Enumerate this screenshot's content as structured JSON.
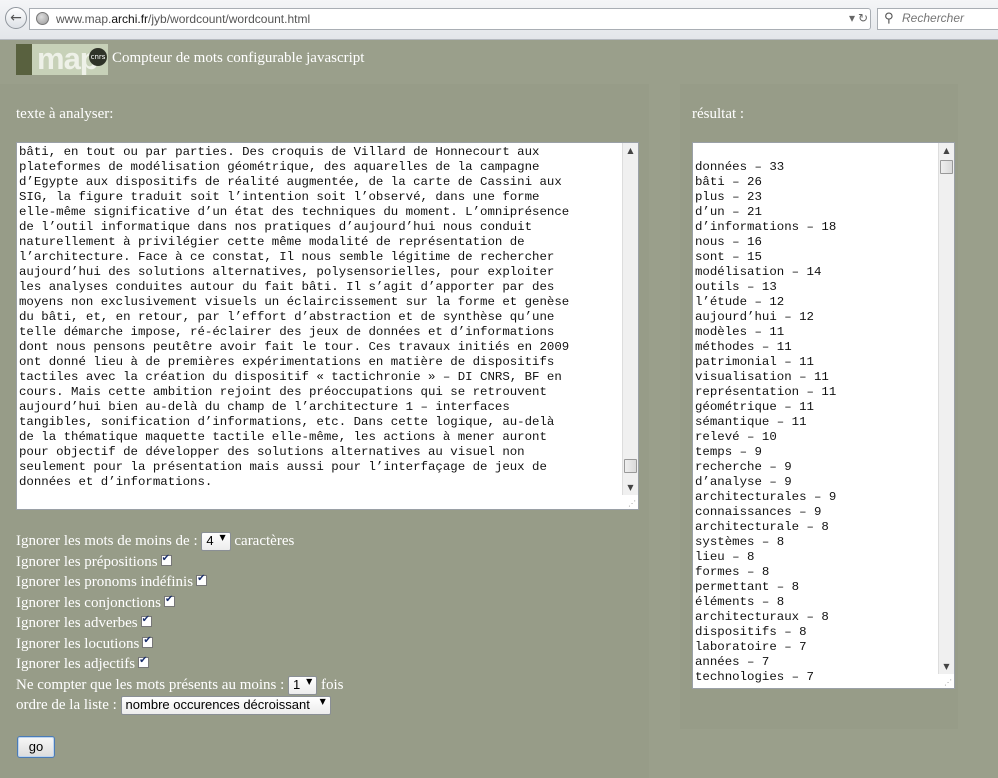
{
  "browser": {
    "url_prefix": "www.map.",
    "url_host": "archi.fr",
    "url_path": "/jyb/wordcount/wordcount.html",
    "search_placeholder": "Rechercher"
  },
  "header": {
    "logo_text": "map",
    "logo_seal": "cnrs",
    "title": "Compteur de mots configurable javascript"
  },
  "input": {
    "label": "texte à analyser:",
    "lines": [
      "bâti, en tout ou par parties. Des croquis de Villard de Honnecourt aux",
      "plateformes de modélisation géométrique, des aquarelles de la campagne",
      "d’Egypte aux dispositifs de réalité augmentée, de la carte de Cassini aux",
      "SIG, la figure traduit soit l’intention soit l’observé, dans une forme",
      "elle-même significative d’un état des techniques du moment. L’omniprésence",
      "de l’outil informatique dans nos pratiques d’aujourd’hui nous conduit",
      "naturellement à privilégier cette même modalité de représentation de",
      "l’architecture. Face à ce constat, Il nous semble légitime de rechercher",
      "aujourd’hui des solutions alternatives, polysensorielles, pour exploiter",
      "les analyses conduites autour du fait bâti. Il s’agit d’apporter par des",
      "moyens non exclusivement visuels un éclaircissement sur la forme et genèse",
      "du bâti, et, en retour, par l’effort d’abstraction et de synthèse qu’une",
      "telle démarche impose, ré-éclairer des jeux de données et d’informations",
      "dont nous pensons peutêtre avoir fait le tour. Ces travaux initiés en 2009",
      "ont donné lieu à de premières expérimentations en matière de dispositifs",
      "tactiles avec la création du dispositif « tactichronie » – DI CNRS, BF en",
      "cours. Mais cette ambition rejoint des préoccupations qui se retrouvent",
      "aujourd’hui bien au-delà du champ de l’architecture 1 – interfaces",
      "tangibles, sonification d’informations, etc. Dans cette logique, au-delà",
      "de la thématique maquette tactile elle-même, les actions à mener auront",
      "pour objectif de développer des solutions alternatives au visuel non",
      "seulement pour la présentation mais aussi pour l’interfaçage de jeux de",
      "données et d’informations."
    ]
  },
  "result": {
    "label": "résultat :",
    "lines": [
      "",
      "données – 33",
      "bâti – 26",
      "plus – 23",
      "d’un – 21",
      "d’informations – 18",
      "nous – 16",
      "sont – 15",
      "modélisation – 14",
      "outils – 13",
      "l’étude – 12",
      "aujourd’hui – 12",
      "modèles – 11",
      "méthodes – 11",
      "patrimonial – 11",
      "visualisation – 11",
      "représentation – 11",
      "géométrique – 11",
      "sémantique – 11",
      "relevé – 10",
      "temps – 9",
      "recherche – 9",
      "d’analyse – 9",
      "architecturales – 9",
      "connaissances – 9",
      "architecturale – 8",
      "systèmes – 8",
      "lieu – 8",
      "formes – 8",
      "permettant – 8",
      "éléments – 8",
      "architecturaux – 8",
      "dispositifs – 8",
      "laboratoire – 7",
      "années – 7",
      "technologies – 7"
    ]
  },
  "options": {
    "min_length_before": "Ignorer les mots de moins de :",
    "min_length_value": "4",
    "min_length_after": "caractères",
    "checkboxes": [
      "Ignorer les prépositions",
      "Ignorer les pronoms indéfinis",
      "Ignorer les conjonctions",
      "Ignorer les adverbes",
      "Ignorer les locutions",
      "Ignorer les adjectifs"
    ],
    "min_count_before": "Ne compter que les mots présents au moins :",
    "min_count_value": "1",
    "min_count_after": "fois",
    "order_label": "ordre de la liste :",
    "order_value": "nombre occurences décroissant",
    "submit_label": "go"
  }
}
